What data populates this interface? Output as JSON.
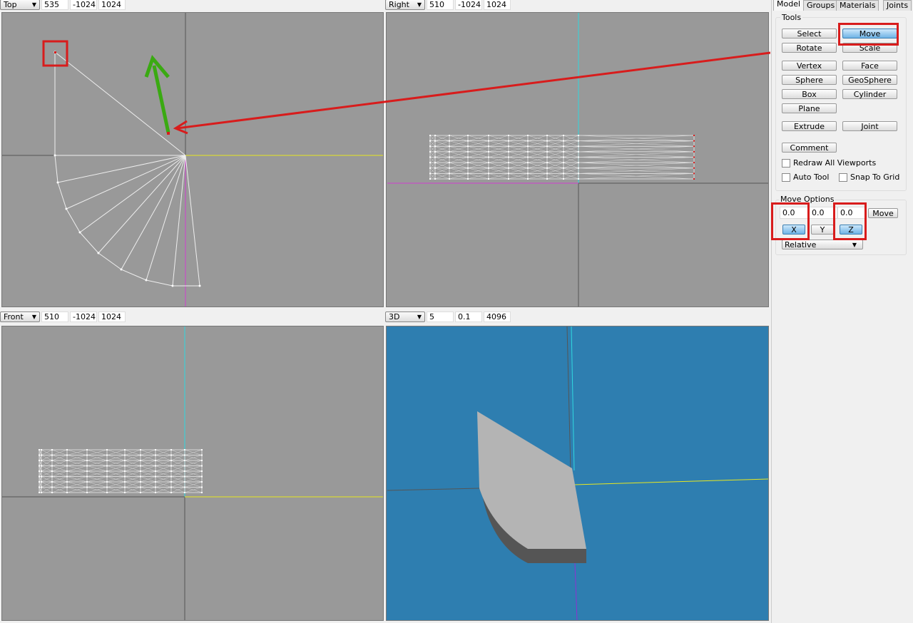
{
  "viewports": [
    {
      "view": "Top",
      "fields": [
        "535",
        "-1024",
        "1024"
      ]
    },
    {
      "view": "Right",
      "fields": [
        "510",
        "-1024",
        "1024"
      ]
    },
    {
      "view": "Front",
      "fields": [
        "510",
        "-1024",
        "1024"
      ]
    },
    {
      "view": "3D",
      "fields": [
        "5",
        "0.1",
        "4096"
      ]
    }
  ],
  "tabs": [
    "Model",
    "Groups",
    "Materials",
    "Joints"
  ],
  "tools": {
    "title": "Tools",
    "buttons": [
      "Select",
      "Move",
      "Rotate",
      "Scale",
      "Vertex",
      "Face",
      "Sphere",
      "GeoSphere",
      "Box",
      "Cylinder",
      "Plane",
      "Extrude",
      "Joint",
      "Comment"
    ],
    "active": "Move",
    "checkboxes": [
      {
        "label": "Redraw All Viewports",
        "checked": false
      },
      {
        "label": "Auto Tool",
        "checked": false
      },
      {
        "label": "Snap To Grid",
        "checked": false
      }
    ]
  },
  "move_options": {
    "title": "Move Options",
    "x": "0.0",
    "y": "0.0",
    "z": "0.0",
    "move_label": "Move",
    "axes": [
      "X",
      "Y",
      "Z"
    ],
    "active_axes": [
      "X",
      "Z"
    ],
    "mode": "Relative"
  },
  "colors": {
    "viewport_bg": "#999999",
    "view3d_bg": "#2e7eb0",
    "annotation": "#d81c1c",
    "arrow_green": "#3aaa12"
  }
}
